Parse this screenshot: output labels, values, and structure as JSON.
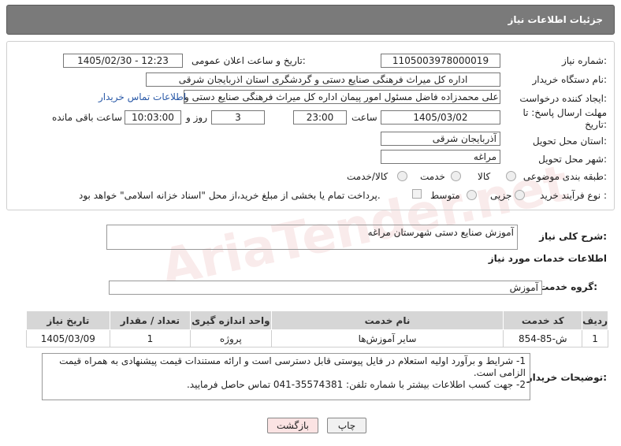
{
  "header": {
    "title": "جزئیات اطلاعات نیاز"
  },
  "form": {
    "need_number_label": "شماره نیاز:",
    "need_number": "1105003978000019",
    "announce_label": "تاریخ و ساعت اعلان عمومی:",
    "announce_value": "1405/02/30 - 12:23",
    "buyer_label": "نام دستگاه خریدار:",
    "buyer_value": "اداره کل میراث فرهنگی  صنایع دستی و گردشگری استان اذربایجان شرقی",
    "requester_label": "ایجاد کننده درخواست:",
    "requester_value": "علی محمدزاده فاضل مسئول امور پیمان اداره کل میراث فرهنگی  صنایع دستی و",
    "contact_link": "اطلاعات تماس خریدار",
    "deadline_label": "مهلت ارسال پاسخ: تا تاریخ:",
    "deadline_date": "1405/03/02",
    "time_label": "ساعت",
    "deadline_time": "23:00",
    "days_value": "3",
    "days_label": "روز و",
    "remaining_time": "10:03:00",
    "remaining_label": "ساعت باقی مانده",
    "province_label": "استان محل تحویل:",
    "province_value": "آذربایجان شرقی",
    "city_label": "شهر محل تحویل:",
    "city_value": "مراغه",
    "category_label": "طبقه بندی موضوعی:",
    "category_options": [
      "کالا",
      "خدمت",
      "کالا/خدمت"
    ],
    "process_label": "نوع فرآیند خرید :",
    "process_options": [
      "جزیی",
      "متوسط"
    ],
    "payment_note": "پرداخت تمام یا بخشی از مبلغ خرید،از محل \"اسناد خزانه اسلامی\" خواهد بود."
  },
  "summary": {
    "label": "شرح کلی نیاز:",
    "value": "آموزش صنایع دستی شهرستان مراغه"
  },
  "services": {
    "section_title": "اطلاعات خدمات مورد نیاز",
    "group_label": "گروه خدمت:",
    "group_value": "آموزش",
    "columns": [
      "ردیف",
      "کد خدمت",
      "نام خدمت",
      "واحد اندازه گیری",
      "تعداد / مقدار",
      "تاریخ نیاز"
    ],
    "rows": [
      {
        "row": "1",
        "code": "ش-85-854",
        "name": "سایر آموزش‌ها",
        "unit": "پروژه",
        "qty": "1",
        "date": "1405/03/09"
      }
    ]
  },
  "notes": {
    "label": "توضیحات خریدار:",
    "line1": "1- شرایط و برآورد اولیه استعلام در فایل پیوستی قابل دسترسی است و ارائه مستندات قیمت پیشنهادی به همراه قیمت الزامی است.",
    "line2": "2- جهت کسب اطلاعات بیشتر  با شماره تلفن: 35574381-041  تماس حاصل فرمایید."
  },
  "buttons": {
    "print": "چاپ",
    "back": "بازگشت"
  },
  "watermark": "AriaTender.net",
  "colors": {
    "header_bg": "#7a7a7a",
    "link": "#2b5aa8",
    "back_button_bg": "#fbe3e3"
  }
}
